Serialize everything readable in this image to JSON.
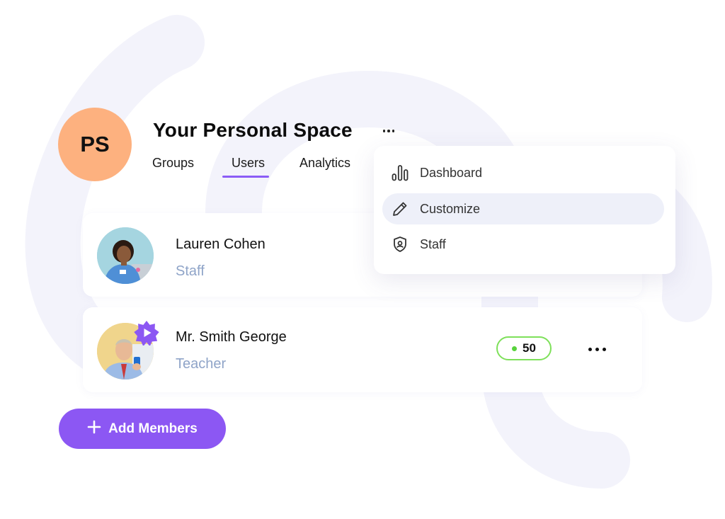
{
  "space": {
    "initials": "PS",
    "title": "Your Personal Space",
    "avatar_color": "#fdb17f"
  },
  "tabs": [
    {
      "label": "Groups",
      "active": false
    },
    {
      "label": "Users",
      "active": true
    },
    {
      "label": "Analytics",
      "active": false
    }
  ],
  "dropdown": {
    "items": [
      {
        "label": "Dashboard",
        "icon": "bar-chart-icon",
        "active": false
      },
      {
        "label": "Customize",
        "icon": "pencil-icon",
        "active": true
      },
      {
        "label": "Staff",
        "icon": "shield-icon",
        "active": false
      }
    ]
  },
  "users": [
    {
      "name": "Lauren Cohen",
      "role": "Staff"
    },
    {
      "name": "Mr. Smith George",
      "role": "Teacher",
      "score": "50",
      "badge_icon": "play-badge-icon"
    }
  ],
  "actions": {
    "add_members_label": "Add Members"
  },
  "colors": {
    "accent": "#8c57f3",
    "tab_underline": "#8b5cf6",
    "score_border": "#7ee05a",
    "score_dot": "#58d23c",
    "role_text": "#8fa4c8",
    "background_shape": "#f3f3fb"
  }
}
